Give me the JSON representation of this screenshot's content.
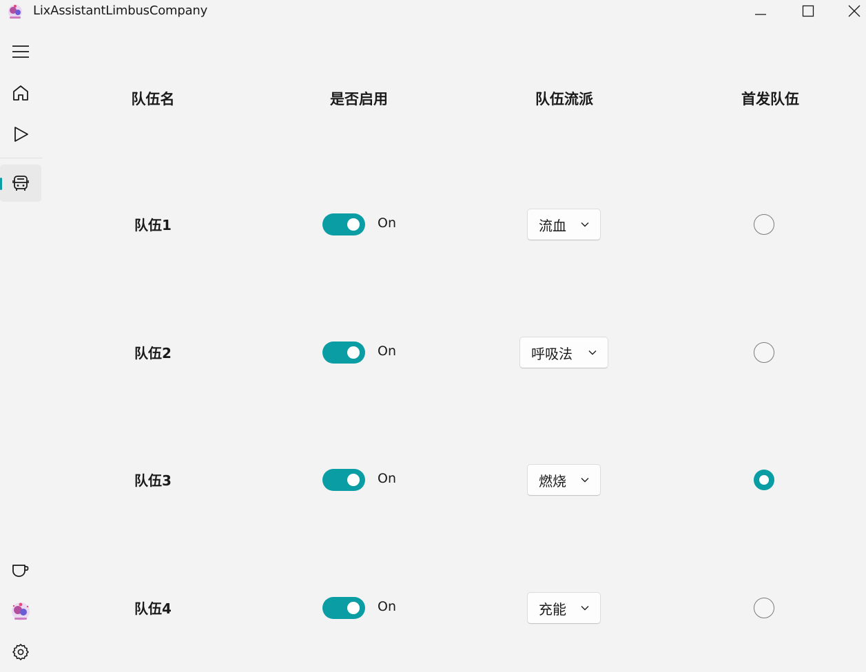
{
  "window": {
    "title": "LixAssistantLimbusCompany",
    "min_icon": "minimize-icon",
    "max_icon": "maximize-icon",
    "close_icon": "close-icon"
  },
  "sidebar": {
    "items": [
      {
        "name": "menu",
        "icon": "hamburger-menu-icon"
      },
      {
        "name": "home",
        "icon": "home-icon"
      },
      {
        "name": "start",
        "icon": "play-icon"
      },
      {
        "name": "teams",
        "icon": "bus-icon",
        "selected": true
      },
      {
        "name": "donate",
        "icon": "cup-icon"
      },
      {
        "name": "avatar",
        "icon": "avatar-icon"
      },
      {
        "name": "settings",
        "icon": "gear-icon"
      }
    ]
  },
  "columns": [
    "队伍名",
    "是否启用",
    "队伍流派",
    "首发队伍"
  ],
  "teams": [
    {
      "name": "队伍1",
      "enabled": true,
      "enabled_label": "On",
      "style": "流血",
      "first": false
    },
    {
      "name": "队伍2",
      "enabled": true,
      "enabled_label": "On",
      "style": "呼吸法",
      "first": false
    },
    {
      "name": "队伍3",
      "enabled": true,
      "enabled_label": "On",
      "style": "燃烧",
      "first": true
    },
    {
      "name": "队伍4",
      "enabled": true,
      "enabled_label": "On",
      "style": "充能",
      "first": false
    }
  ],
  "colors": {
    "accent": "#0a9ea4",
    "background": "#f3f3f3"
  }
}
